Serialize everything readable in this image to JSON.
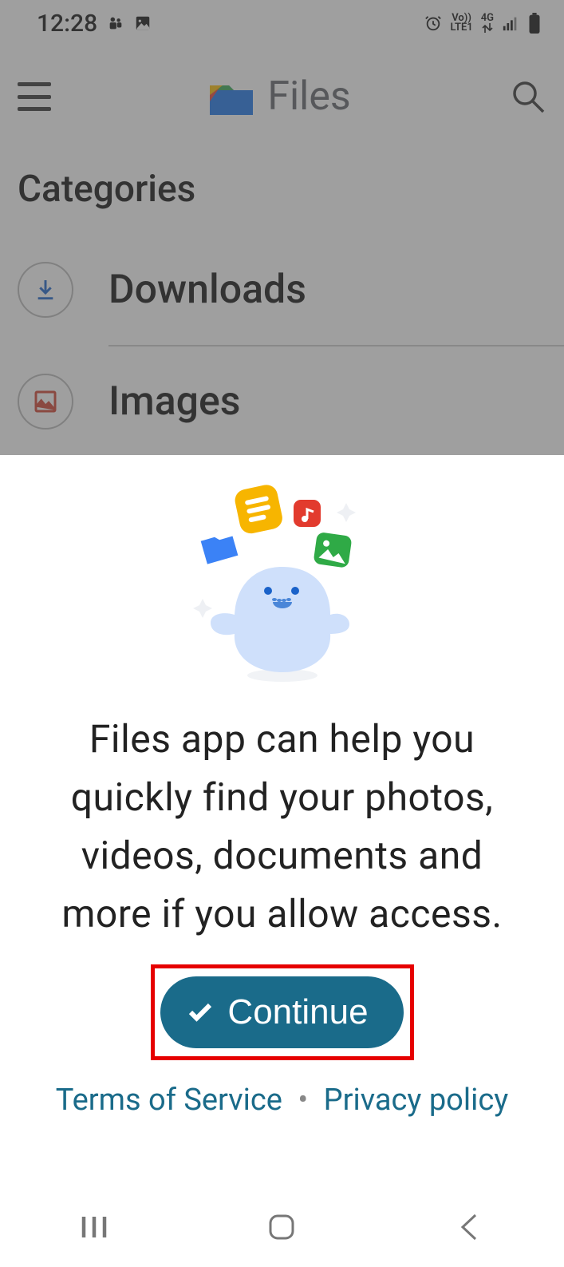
{
  "status_bar": {
    "time": "12:28",
    "network_label": "LTE1",
    "network_gen": "4G",
    "vo_label": "Vo))"
  },
  "app_bar": {
    "title": "Files"
  },
  "categories": {
    "title": "Categories",
    "items": [
      {
        "label": "Downloads"
      },
      {
        "label": "Images"
      }
    ]
  },
  "sheet": {
    "message": "Files app can help you quickly find your photos, videos, documents and more if you allow access.",
    "continue_label": "Continue",
    "tos_label": "Terms of Service",
    "separator": "•",
    "privacy_label": "Privacy policy"
  },
  "icons": {
    "menu": "menu-icon",
    "search": "search-icon",
    "alarm": "alarm-icon",
    "signal": "signal-icon",
    "battery": "battery-icon",
    "teams": "teams-icon",
    "photo_notif": "image-icon",
    "download": "download-icon",
    "image_cat": "image-icon",
    "check": "check-icon"
  }
}
